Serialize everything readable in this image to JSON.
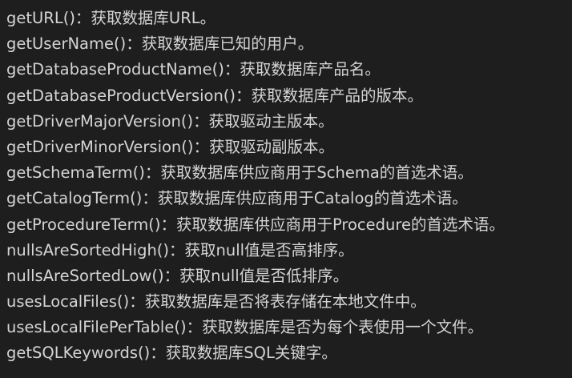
{
  "lines": [
    "getURL()：获取数据库URL。",
    "getUserName()：获取数据库已知的用户。",
    "getDatabaseProductName()：获取数据库产品名。",
    "getDatabaseProductVersion()：获取数据库产品的版本。",
    "getDriverMajorVersion()：获取驱动主版本。",
    "getDriverMinorVersion()：获取驱动副版本。",
    "getSchemaTerm()：获取数据库供应商用于Schema的首选术语。",
    "getCatalogTerm()：获取数据库供应商用于Catalog的首选术语。",
    "getProcedureTerm()：获取数据库供应商用于Procedure的首选术语。",
    "nullsAreSortedHigh()：获取null值是否高排序。",
    "nullsAreSortedLow()：获取null值是否低排序。",
    "usesLocalFiles()：获取数据库是否将表存储在本地文件中。",
    "usesLocalFilePerTable()：获取数据库是否为每个表使用一个文件。",
    "getSQLKeywords()：获取数据库SQL关键字。"
  ]
}
